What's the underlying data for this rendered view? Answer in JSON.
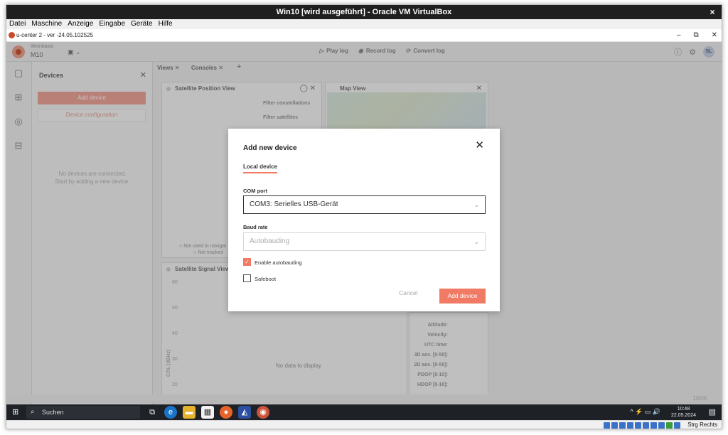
{
  "vbox": {
    "title": "Win10 [wird ausgeführt] - Oracle VM VirtualBox",
    "close": "×",
    "menu": [
      "Datei",
      "Maschine",
      "Anzeige",
      "Eingabe",
      "Geräte",
      "Hilfe"
    ],
    "host_key": "Strg Rechts"
  },
  "guest_window": {
    "title": "u-center 2 - ver -24.05.102525",
    "minimize": "–",
    "maximize": "⧉",
    "close": "✕"
  },
  "app": {
    "device_sub": "Weinbasis",
    "device_model": "M10",
    "header_actions": [
      {
        "icon": "▷",
        "label": "Play log"
      },
      {
        "icon": "◉",
        "label": "Record log"
      },
      {
        "icon": "⟳",
        "label": "Convert log"
      }
    ],
    "avatar": "SL",
    "devices_panel": {
      "title": "Devices",
      "add_device": "Add device",
      "device_configuration": "Device configuration",
      "empty_line1": "No devices are connected.",
      "empty_line2": "Start by adding a new device."
    },
    "view_tabs": [
      "Views",
      "Consoles"
    ],
    "satellite_position": {
      "title": "Satellite Position View",
      "filter_constellations": "Filter constellations",
      "filter_satellites": "Filter satellites",
      "legend_not_used": "Not used in navigat",
      "legend_not_tracked": "Not tracked"
    },
    "map_view": {
      "title": "Map View"
    },
    "signal_view": {
      "title": "Satellite Signal View",
      "ticks": [
        "60",
        "50",
        "40",
        "30",
        "20"
      ],
      "axis_label": "C/N₀ [dBHz]",
      "no_data": "No data to display"
    },
    "info_labels": [
      "Altitude:",
      "Velocity:",
      "UTC time:",
      "3D acc. [0-50]:",
      "2D acc. [0-50]:",
      "PDOP [0-10]:",
      "HDOP [0-10]:"
    ],
    "zoom": "100%"
  },
  "modal": {
    "title": "Add new device",
    "tab": "Local device",
    "com_port_label": "COM port",
    "com_port_value": "COM3: Serielles USB-Gerät",
    "baud_label": "Baud rate",
    "baud_value": "Autobauding",
    "enable_autobauding": "Enable autobauding",
    "enable_autobauding_checked": true,
    "safeboot": "Safeboot",
    "safeboot_checked": false,
    "cancel": "Cancel",
    "add_device": "Add device"
  },
  "taskbar": {
    "search": "Suchen",
    "time": "10:48",
    "date": "22.05.2024"
  },
  "colors": {
    "accent": "#f07a64",
    "accent_muted": "#eea59a"
  }
}
